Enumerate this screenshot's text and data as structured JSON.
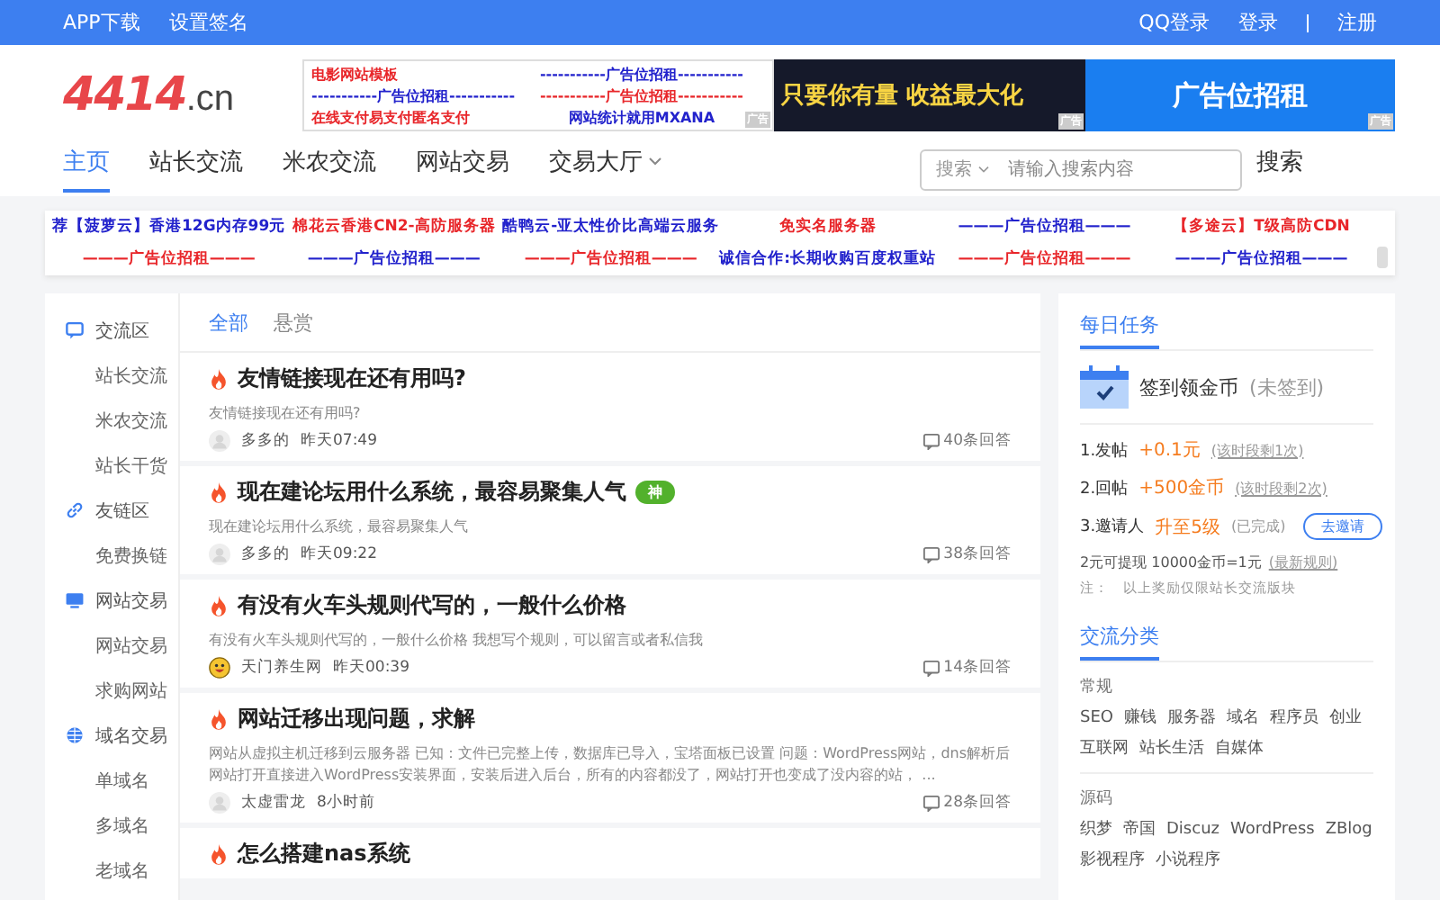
{
  "topbar": {
    "left": [
      "APP下载",
      "设置签名"
    ],
    "right": [
      "QQ登录",
      "登录",
      "注册"
    ]
  },
  "logo": {
    "main": "4414",
    "suffix": ".cn"
  },
  "banner": {
    "text_ads": [
      {
        "text": "电影网站模板",
        "color": "#e8262a"
      },
      {
        "text": "-----------广告位招租-----------",
        "color": "#2222cc"
      },
      {
        "text": "-----------广告位招租-----------",
        "color": "#2222cc"
      },
      {
        "text": "-----------广告位招租-----------",
        "color": "#e8262a"
      },
      {
        "text": "在线支付易支付匿名支付",
        "color": "#e8262a"
      },
      {
        "text": "网站统计就用MXANA",
        "color": "#2222cc"
      }
    ],
    "text_ads_tag": "广告",
    "slogan": "只要你有量 收益最大化",
    "slogan_tag": "广告",
    "promo": "广告位招租",
    "promo_tag": "广告"
  },
  "nav": [
    {
      "label": "主页",
      "selected": true
    },
    {
      "label": "站长交流",
      "selected": false
    },
    {
      "label": "米农交流",
      "selected": false
    },
    {
      "label": "网站交易",
      "selected": false
    },
    {
      "label": "交易大厅",
      "selected": false,
      "dropdown": true
    }
  ],
  "search": {
    "scope": "搜索",
    "placeholder": "请输入搜索内容",
    "button": "搜索"
  },
  "ad_strip": [
    {
      "text": "荐【菠萝云】香港12G内存99元",
      "color": "#2222cc"
    },
    {
      "text": "棉花云香港CN2-高防服务器",
      "color": "#e8262a"
    },
    {
      "text": "酷鸭云-亚太性价比高端云服务",
      "color": "#2222cc"
    },
    {
      "text": "免实名服务器",
      "color": "#e8262a"
    },
    {
      "text": "———广告位招租———",
      "color": "#2222cc"
    },
    {
      "text": "【多途云】T级高防CDN",
      "color": "#e8262a"
    },
    {
      "text": "———广告位招租———",
      "color": "#e8262a"
    },
    {
      "text": "———广告位招租———",
      "color": "#2222cc"
    },
    {
      "text": "———广告位招租———",
      "color": "#e8262a"
    },
    {
      "text": "诚信合作:长期收购百度权重站",
      "color": "#2222cc"
    },
    {
      "text": "———广告位招租———",
      "color": "#e8262a"
    },
    {
      "text": "———广告位招租———",
      "color": "#2222cc"
    }
  ],
  "sidebar": [
    {
      "label": "交流区",
      "children": [
        {
          "label": "站长交流"
        },
        {
          "label": "米农交流"
        },
        {
          "label": "站长干货"
        }
      ]
    },
    {
      "label": "友链区",
      "children": [
        {
          "label": "免费换链"
        }
      ]
    },
    {
      "label": "网站交易",
      "children": [
        {
          "label": "网站交易"
        },
        {
          "label": "求购网站"
        }
      ]
    },
    {
      "label": "域名交易",
      "children": [
        {
          "label": "单域名"
        },
        {
          "label": "多域名"
        },
        {
          "label": "老域名"
        }
      ]
    }
  ],
  "feed_tabs": [
    {
      "label": "全部",
      "selected": true
    },
    {
      "label": "悬赏",
      "selected": false
    }
  ],
  "posts": [
    {
      "title": "友情链接现在还有用吗?",
      "excerpt": "友情链接现在还有用吗?",
      "kind": "plain",
      "author": "多多的",
      "time": "昨天07:49",
      "replies": "40条回答"
    },
    {
      "title": "现在建论坛用什么系统，最容易聚集人气",
      "badge": "神",
      "excerpt": "现在建论坛用什么系统，最容易聚集人气",
      "kind": "plain",
      "author": "多多的",
      "time": "昨天09:22",
      "replies": "38条回答"
    },
    {
      "title": "有没有火车头规则代写的，一般什么价格",
      "excerpt": "有没有火车头规则代写的，一般什么价格 我想写个规则，可以留言或者私信我",
      "kind": "smiley",
      "author": "天门养生网",
      "time": "昨天00:39",
      "replies": "14条回答"
    },
    {
      "title": "网站迁移出现问题，求解",
      "excerpt": "网站从虚拟主机迁移到云服务器 已知：文件已完整上传，数据库已导入，宝塔面板已设置 问题：WordPress网站，dns解析后网站打开直接进入WordPress安装界面，安装后进入后台，所有的内容都没了，网站打开也变成了没内容的站， ...",
      "kind": "plain",
      "author": "太虚雷龙",
      "time": "8小时前",
      "replies": "28条回答"
    },
    {
      "title": "怎么搭建nas系统"
    }
  ],
  "daily": {
    "title": "每日任务",
    "checkin": "签到领金币",
    "checkin_state": "(未签到)",
    "tasks": [
      {
        "label": "1.发帖",
        "reward": "+0.1元",
        "note": "(该时段剩1次)",
        "kind": "link"
      },
      {
        "label": "2.回帖",
        "reward": "+500金币",
        "note": "(该时段剩2次)",
        "kind": "link"
      },
      {
        "label": "3.邀请人",
        "reward": "升至5级",
        "note": "(已完成)",
        "kind": "plain",
        "button": "去邀请"
      }
    ],
    "rule": "2元可提现 10000金币=1元",
    "rule_link": "(最新规则)",
    "note_label": "注：",
    "note": "以上奖励仅限站长交流版块"
  },
  "categories": {
    "title": "交流分类",
    "groups": [
      {
        "name": "常规",
        "tags": [
          "SEO",
          "赚钱",
          "服务器",
          "域名",
          "程序员",
          "创业",
          "互联网",
          "站长生活",
          "自媒体"
        ]
      },
      {
        "name": "源码",
        "tags": [
          "织梦",
          "帝国",
          "Discuz",
          "WordPress",
          "ZBlog",
          "影视程序",
          "小说程序"
        ]
      }
    ]
  }
}
